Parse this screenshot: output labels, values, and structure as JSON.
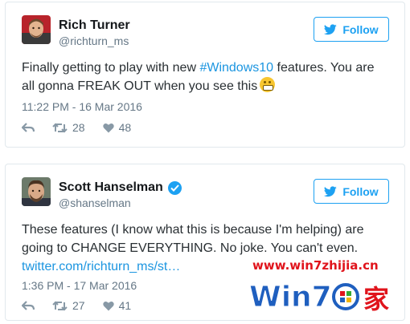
{
  "tweets": [
    {
      "name": "Rich Turner",
      "handle": "@richturn_ms",
      "follow_label": "Follow",
      "text_before": "Finally getting to play with new ",
      "hashtag": "#Windows10",
      "text_after": " features. You are all gonna FREAK OUT when you see this",
      "emoji": "grimacing-face",
      "timestamp": "11:22 PM - 16 Mar 2016",
      "retweets": "28",
      "likes": "48"
    },
    {
      "name": "Scott Hanselman",
      "handle": "@shanselman",
      "follow_label": "Follow",
      "verified": true,
      "text": "These features (I know what this is because I'm helping) are going to CHANGE EVERYTHING. No joke. You can't even.",
      "link": "twitter.com/richturn_ms/st…",
      "timestamp": "1:36 PM - 17 Mar 2016",
      "retweets": "27",
      "likes": "41"
    }
  ],
  "watermark": {
    "url": "www.win7zhijia.cn",
    "logo_text": "Win7",
    "logo_suffix": "家"
  },
  "colors": {
    "twitter_blue": "#1da1f2",
    "link": "#1b95e0",
    "muted": "#657786",
    "watermark_red": "#e0141c",
    "watermark_blue": "#1f5fbf"
  }
}
